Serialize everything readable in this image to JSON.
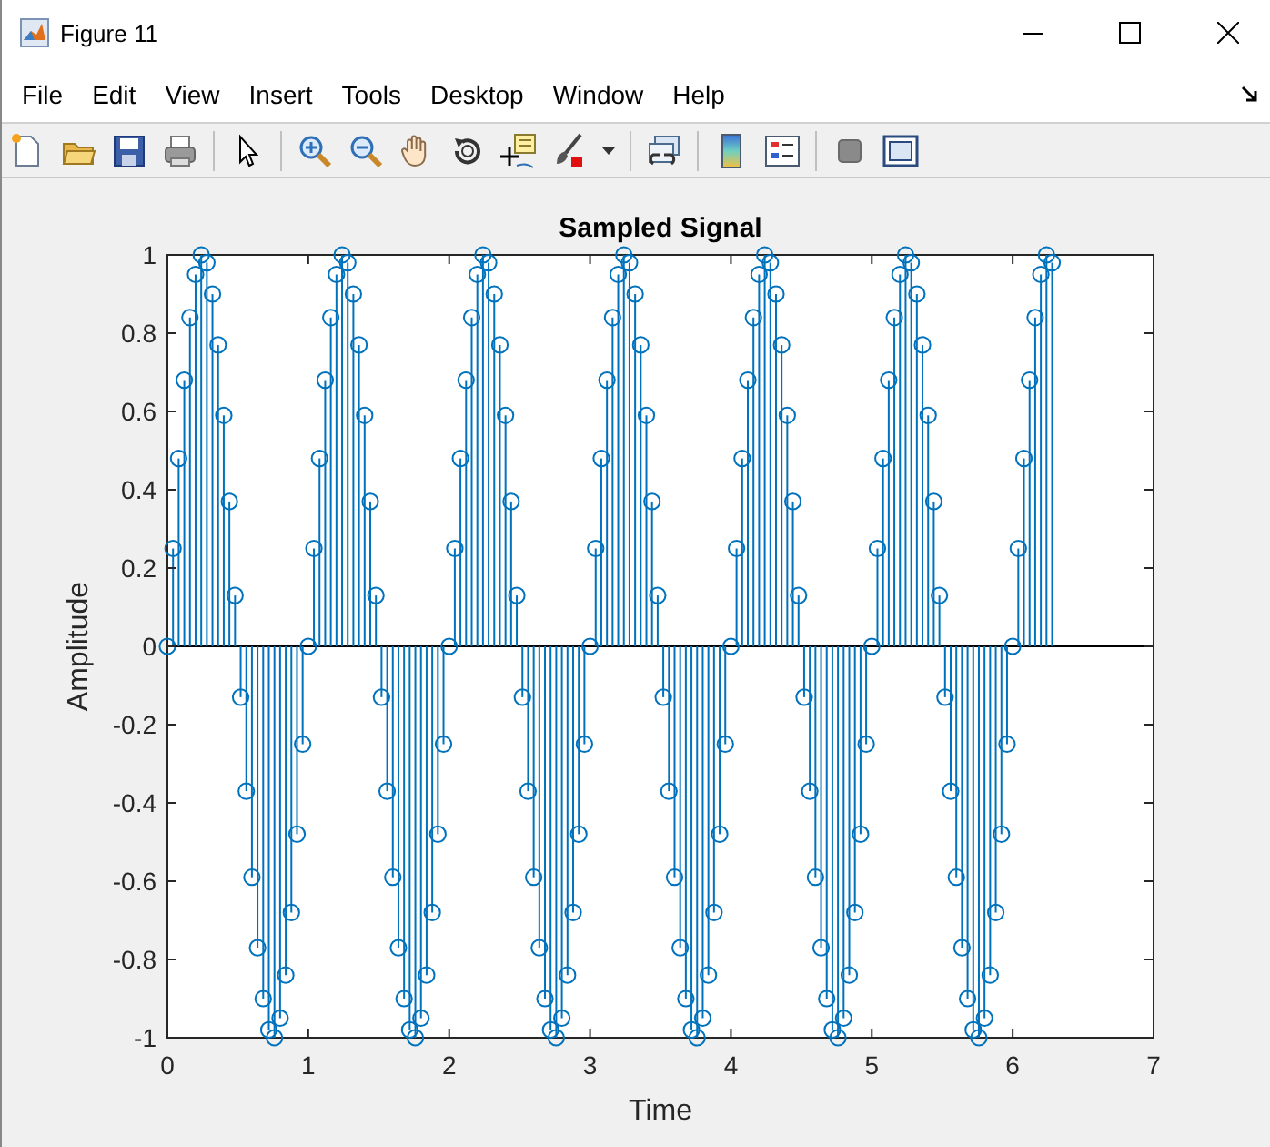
{
  "window": {
    "title": "Figure 11"
  },
  "menu": [
    "File",
    "Edit",
    "View",
    "Insert",
    "Tools",
    "Desktop",
    "Window",
    "Help"
  ],
  "axes": {
    "chart_data": {
      "type": "scatter",
      "title": "Sampled Signal",
      "xlabel": "Time",
      "ylabel": "Amplitude",
      "xlim": [
        0,
        7
      ],
      "ylim": [
        -1,
        1
      ],
      "xticks": [
        0,
        1,
        2,
        3,
        4,
        5,
        6,
        7
      ],
      "yticks": [
        -1,
        -0.8,
        -0.6,
        -0.4,
        -0.2,
        0,
        0.2,
        0.4,
        0.6,
        0.8,
        1
      ],
      "x": [
        0,
        0.04,
        0.08,
        0.12,
        0.16,
        0.2,
        0.24,
        0.28,
        0.32,
        0.36,
        0.4,
        0.44,
        0.48,
        0.52,
        0.56,
        0.6,
        0.64,
        0.68,
        0.72,
        0.76,
        0.8,
        0.84,
        0.88,
        0.92,
        0.96,
        1,
        1.04,
        1.08,
        1.12,
        1.16,
        1.2,
        1.24,
        1.28,
        1.32,
        1.36,
        1.4,
        1.44,
        1.48,
        1.52,
        1.56,
        1.6,
        1.64,
        1.68,
        1.72,
        1.76,
        1.8,
        1.84,
        1.88,
        1.92,
        1.96,
        2,
        2.04,
        2.08,
        2.12,
        2.16,
        2.2,
        2.24,
        2.28,
        2.32,
        2.36,
        2.4,
        2.44,
        2.48,
        2.52,
        2.56,
        2.6,
        2.64,
        2.68,
        2.72,
        2.76,
        2.8,
        2.84,
        2.88,
        2.92,
        2.96,
        3,
        3.04,
        3.08,
        3.12,
        3.16,
        3.2,
        3.24,
        3.28,
        3.32,
        3.36,
        3.4,
        3.44,
        3.48,
        3.52,
        3.56,
        3.6,
        3.64,
        3.68,
        3.72,
        3.76,
        3.8,
        3.84,
        3.88,
        3.92,
        3.96,
        4,
        4.04,
        4.08,
        4.12,
        4.16,
        4.2,
        4.24,
        4.28,
        4.32,
        4.36,
        4.4,
        4.44,
        4.48,
        4.52,
        4.56,
        4.6,
        4.64,
        4.68,
        4.72,
        4.76,
        4.8,
        4.84,
        4.88,
        4.92,
        4.96,
        5,
        5.04,
        5.08,
        5.12,
        5.16,
        5.2,
        5.24,
        5.28,
        5.32,
        5.36,
        5.4,
        5.44,
        5.48,
        5.52,
        5.56,
        5.6,
        5.64,
        5.68,
        5.72,
        5.76,
        5.8,
        5.84,
        5.88,
        5.92,
        5.96,
        6,
        6.04,
        6.08,
        6.12,
        6.16,
        6.2,
        6.24,
        6.28
      ],
      "series": [
        {
          "color": "#0072bd",
          "values": [
            0,
            0.25,
            0.48,
            0.68,
            0.84,
            0.95,
            1,
            0.98,
            0.9,
            0.77,
            0.59,
            0.37,
            0.13,
            -0.13,
            -0.37,
            -0.59,
            -0.77,
            -0.9,
            -0.98,
            -1,
            -0.95,
            -0.84,
            -0.68,
            -0.48,
            -0.25,
            0,
            0.25,
            0.48,
            0.68,
            0.84,
            0.95,
            1,
            0.98,
            0.9,
            0.77,
            0.59,
            0.37,
            0.13,
            -0.13,
            -0.37,
            -0.59,
            -0.77,
            -0.9,
            -0.98,
            -1,
            -0.95,
            -0.84,
            -0.68,
            -0.48,
            -0.25,
            0,
            0.25,
            0.48,
            0.68,
            0.84,
            0.95,
            1,
            0.98,
            0.9,
            0.77,
            0.59,
            0.37,
            0.13,
            -0.13,
            -0.37,
            -0.59,
            -0.77,
            -0.9,
            -0.98,
            -1,
            -0.95,
            -0.84,
            -0.68,
            -0.48,
            -0.25,
            0,
            0.25,
            0.48,
            0.68,
            0.84,
            0.95,
            1,
            0.98,
            0.9,
            0.77,
            0.59,
            0.37,
            0.13,
            -0.13,
            -0.37,
            -0.59,
            -0.77,
            -0.9,
            -0.98,
            -1,
            -0.95,
            -0.84,
            -0.68,
            -0.48,
            -0.25,
            0,
            0.25,
            0.48,
            0.68,
            0.84,
            0.95,
            1,
            0.98,
            0.9,
            0.77,
            0.59,
            0.37,
            0.13,
            -0.13,
            -0.37,
            -0.59,
            -0.77,
            -0.9,
            -0.98,
            -1,
            -0.95,
            -0.84,
            -0.68,
            -0.48,
            -0.25,
            0,
            0.25,
            0.48,
            0.68,
            0.84,
            0.95,
            1,
            0.98,
            0.9,
            0.77,
            0.59,
            0.37,
            0.13,
            -0.13,
            -0.37,
            -0.59,
            -0.77,
            -0.9,
            -0.98,
            -1,
            -0.95,
            -0.84,
            -0.68,
            -0.48,
            -0.25,
            0,
            0.25,
            0.48,
            0.68,
            0.84,
            0.95,
            1,
            0.98
          ]
        }
      ]
    }
  }
}
